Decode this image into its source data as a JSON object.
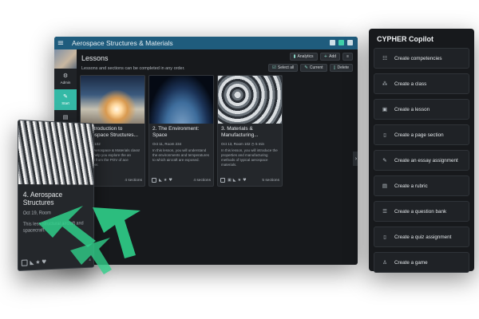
{
  "app": {
    "title": "Aerospace Structures & Materials",
    "menu_icon": "≡",
    "accent": "#34b9a6",
    "titlebar_color": "#1f5c7d"
  },
  "sidebar": {
    "items": [
      {
        "label": "Admin",
        "icon": "gear-icon",
        "glyph": "⚙"
      },
      {
        "label": "Start",
        "icon": "pin-icon",
        "glyph": "✎"
      },
      {
        "label": "Assignments",
        "icon": "clipboard-icon",
        "glyph": "▤"
      },
      {
        "label": "Gradebook",
        "icon": "grid-icon",
        "glyph": "▦"
      }
    ]
  },
  "lessons": {
    "title": "Lessons",
    "subtitle": "Lessons and sections can be completed in any order.",
    "analytics_label": "Analytics",
    "add_label": "Add",
    "select_all_label": "Select all",
    "current_label": "Current",
    "delete_label": "Delete",
    "cards": [
      {
        "title": "1. Introduction to Aerospace Structures...",
        "meta": "Room 102",
        "desc": "to the Aerospace & Materials class! This t help you explore the an aircraft from the POV of ace engineer.",
        "sections": "4 sections"
      },
      {
        "title": "2. The Environment: Space",
        "meta": "Oct 11, Room 234",
        "desc": "In this lesson, you will understand the environments and temperatures to which aircraft are exposed.",
        "sections": "4 sections"
      },
      {
        "title": "3. Materials & Manufacturing...",
        "meta": "Oct 13, Room 102",
        "duration": "5 min",
        "desc": "In this lesson, you will introduce the properties and manufacturing methods of typical aerospace materials.",
        "sections": "5 sections"
      }
    ]
  },
  "floating_card": {
    "title": "4. Aerospace Structures",
    "meta": "Oct 19, Room",
    "desc": "This less structural aircraft and spacecraft.",
    "sections": "4"
  },
  "copilot": {
    "title": "CYPHER Copilot",
    "items": [
      {
        "label": "Create competencies",
        "icon": "list-icon",
        "glyph": "☷"
      },
      {
        "label": "Create a class",
        "icon": "nodes-icon",
        "glyph": "⁂"
      },
      {
        "label": "Create a lesson",
        "icon": "book-icon",
        "glyph": "▣"
      },
      {
        "label": "Create a page section",
        "icon": "page-icon",
        "glyph": "▯"
      },
      {
        "label": "Create an essay assignment",
        "icon": "pencil-icon",
        "glyph": "✎"
      },
      {
        "label": "Create a rubric",
        "icon": "table-icon",
        "glyph": "▤"
      },
      {
        "label": "Create a question bank",
        "icon": "checklist-icon",
        "glyph": "☰"
      },
      {
        "label": "Create a quiz assignment",
        "icon": "quiz-icon",
        "glyph": "▯"
      },
      {
        "label": "Create a game",
        "icon": "trophy-icon",
        "glyph": "♙"
      }
    ]
  }
}
